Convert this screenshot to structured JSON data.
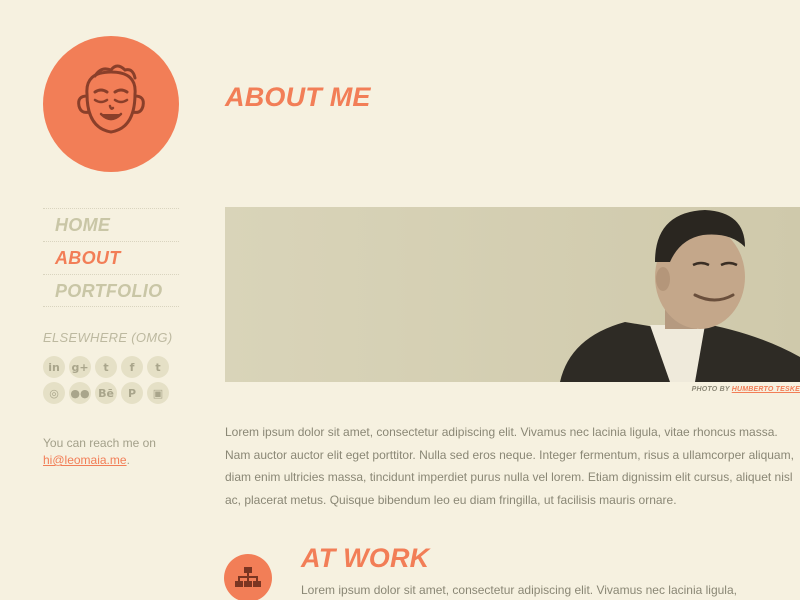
{
  "nav": {
    "items": [
      {
        "label": "HOME",
        "active": false
      },
      {
        "label": "ABOUT",
        "active": true
      },
      {
        "label": "PORTFOLIO",
        "active": false
      }
    ]
  },
  "elsewhere": {
    "title": "ELSEWHERE (OMG)",
    "icons": [
      {
        "name": "linkedin-icon",
        "glyph": "in"
      },
      {
        "name": "google-plus-icon",
        "glyph": "g+"
      },
      {
        "name": "twitter-icon",
        "glyph": "t"
      },
      {
        "name": "facebook-icon",
        "glyph": "f"
      },
      {
        "name": "tumblr-icon",
        "glyph": "t"
      },
      {
        "name": "dribbble-icon",
        "glyph": "◎"
      },
      {
        "name": "flickr-icon",
        "glyph": "●●"
      },
      {
        "name": "behance-icon",
        "glyph": "Bē"
      },
      {
        "name": "pinterest-icon",
        "glyph": "P"
      },
      {
        "name": "instagram-icon",
        "glyph": "▣"
      }
    ]
  },
  "contact": {
    "prefix": "You can reach me on",
    "email": "hi@leomaia.me",
    "suffix": "."
  },
  "about": {
    "title": "ABOUT ME",
    "photo_credit_prefix": "PHOTO BY",
    "photo_credit_name": "HUMBERTO TESKE",
    "paragraph": "Lorem ipsum dolor sit amet, consectetur adipiscing elit. Vivamus nec lacinia ligula, vitae rhoncus massa. Nam auctor auctor elit eget porttitor. Nulla sed eros neque. Integer fermentum, risus a ullamcorper aliquam, diam enim ultricies massa, tincidunt imperdiet purus nulla vel lorem. Etiam dignissim elit cursus, aliquet nisl ac, placerat metus. Quisque bibendum leo eu diam fringilla, ut facilisis mauris ornare."
  },
  "work": {
    "title": "AT WORK",
    "icon": "sitemap-icon",
    "paragraph": "Lorem ipsum dolor sit amet, consectetur adipiscing elit. Vivamus nec lacinia ligula,"
  },
  "colors": {
    "background": "#f6f1e0",
    "accent": "#f27e57",
    "muted": "#c9c6a6"
  }
}
